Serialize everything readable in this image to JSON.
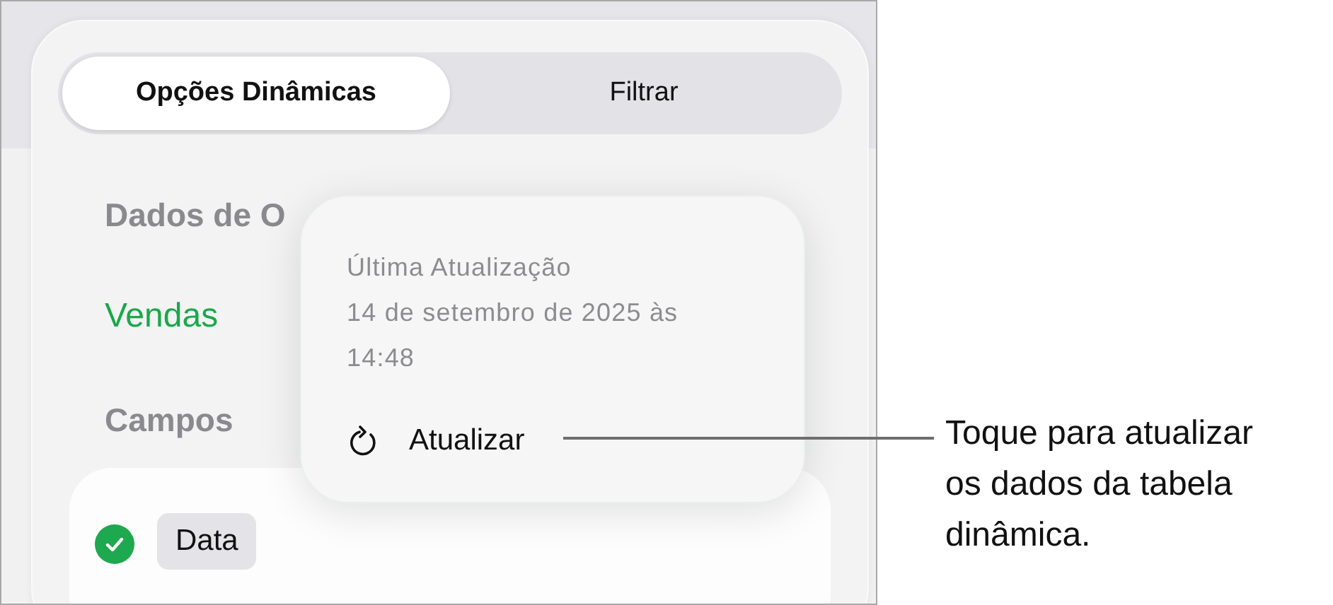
{
  "tabs": [
    {
      "label": "Opções Dinâmicas",
      "selected": true
    },
    {
      "label": "Filtrar",
      "selected": false
    }
  ],
  "source_heading": "Dados de O",
  "source_value": "Vendas",
  "fields_heading": "Campos",
  "fields": [
    {
      "label": "Data",
      "checked": true
    }
  ],
  "popover": {
    "title": "Última Atualização",
    "timestamp": "14 de setembro de 2025 às\n14:48",
    "refresh_button": "Atualizar"
  },
  "callout": "Toque para atualizar\nos dados da tabela\ndinâmica."
}
